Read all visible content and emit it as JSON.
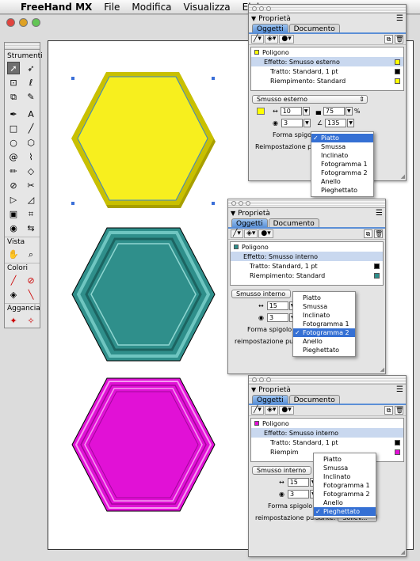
{
  "menubar": {
    "app": "FreeHand MX",
    "items": [
      "File",
      "Modifica",
      "Visualizza",
      "Elabora"
    ]
  },
  "tools": {
    "title": "Strumenti",
    "sections": {
      "view": "Vista",
      "colors": "Colori",
      "link": "Aggancia"
    }
  },
  "panels": [
    {
      "title": "Proprietà",
      "tabs": [
        "Oggetti",
        "Documento"
      ],
      "object": "Poligono",
      "object_color": "#ffff00",
      "rows": [
        {
          "label": "Effetto: Smusso esterno",
          "swatch": "#ffff00"
        },
        {
          "label": "Tratto: Standard, 1 pt",
          "swatch": "#000000"
        },
        {
          "label": "Riempimento: Standard",
          "swatch": "#ffff00"
        }
      ],
      "effect": "Smusso esterno",
      "color_swatch": "#ffff00",
      "width": "10",
      "contrast": "75",
      "softness": "3",
      "angle": "135",
      "edge_label": "Forma spigolo:",
      "reset_label": "Reimpostazione pulsa",
      "options": [
        "Piatto",
        "Smussa",
        "Inclinato",
        "Fotogramma 1",
        "Fotogramma 2",
        "Anello",
        "Pieghettato"
      ],
      "selected": "Piatto"
    },
    {
      "title": "Proprietà",
      "tabs": [
        "Oggetti",
        "Documento"
      ],
      "object": "Poligono",
      "object_color": "#2e8f8c",
      "rows": [
        {
          "label": "Effetto: Smusso interno",
          "swatch": null
        },
        {
          "label": "Tratto: Standard, 1 pt",
          "swatch": "#000000"
        },
        {
          "label": "Riempimento: Standard",
          "swatch": "#2e8f8c"
        }
      ],
      "effect": "Smusso interno",
      "width": "15",
      "softness": "3",
      "edge_label": "Forma spigolo:",
      "reset_label": "reimpostazione pulsa",
      "options": [
        "Piatto",
        "Smussa",
        "Inclinato",
        "Fotogramma 1",
        "Fotogramma 2",
        "Anello",
        "Pieghettato"
      ],
      "selected": "Fotogramma 2"
    },
    {
      "title": "Proprietà",
      "tabs": [
        "Oggetti",
        "Documento"
      ],
      "object": "Poligono",
      "object_color": "#e40fd8",
      "rows": [
        {
          "label": "Effetto: Smusso interno",
          "swatch": null
        },
        {
          "label": "Tratto: Standard, 1 pt",
          "swatch": "#000000"
        },
        {
          "label": "Riempim",
          "swatch": "#e40fd8"
        }
      ],
      "effect": "Smusso interno",
      "width": "15",
      "softness": "3",
      "edge_label": "Forma spigolo:",
      "reset_label": "reimpostazione pulsante:",
      "reset_value": "Sollev...",
      "options": [
        "Piatto",
        "Smussa",
        "Inclinato",
        "Fotogramma 1",
        "Fotogramma 2",
        "Anello",
        "Pieghettato"
      ],
      "selected": "Pieghettato"
    }
  ],
  "shapes": [
    {
      "name": "yellow",
      "fill": "#f7ef1e",
      "edge": "#c9c000",
      "dark": "#a89f00"
    },
    {
      "name": "teal",
      "fill": "#2f8f8b",
      "edge": "#5bb8b3",
      "dark": "#1c6461"
    },
    {
      "name": "magenta",
      "fill": "#e111d6",
      "edge": "#f36bec",
      "dark": "#a3069b"
    }
  ]
}
